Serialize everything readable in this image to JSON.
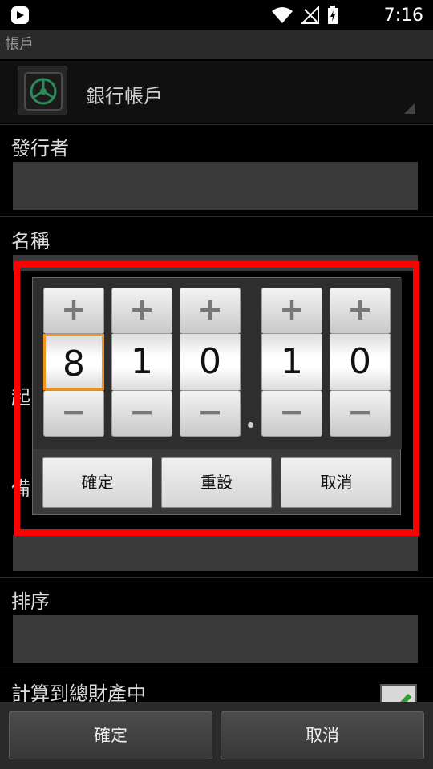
{
  "status_bar": {
    "time": "7:16",
    "icons": [
      "app-badge-icon",
      "wifi-icon",
      "no-signal-icon",
      "battery-charging-icon"
    ]
  },
  "form": {
    "account_section_title": "帳戶",
    "account_type": "銀行帳戶",
    "issuer_label": "發行者",
    "issuer_value": "",
    "name_label": "名稱",
    "start_label_partial": "起",
    "note_label_partial": "備",
    "order_label": "排序",
    "order_value": "",
    "include_total_label": "計算到總財產中",
    "include_total_checked": true
  },
  "number_picker": {
    "plus_symbol": "+",
    "minus_symbol": "−",
    "digits": [
      "8",
      "1",
      "0",
      "1",
      "0"
    ],
    "decimal_point": ".",
    "focused_index": 0,
    "buttons": {
      "confirm": "確定",
      "reset": "重設",
      "cancel": "取消"
    }
  },
  "bottom_bar": {
    "confirm": "確定",
    "cancel": "取消"
  },
  "colors": {
    "highlight": "#ff0000",
    "focus": "#f0931f",
    "checkbox_check": "#2e9e2e"
  }
}
